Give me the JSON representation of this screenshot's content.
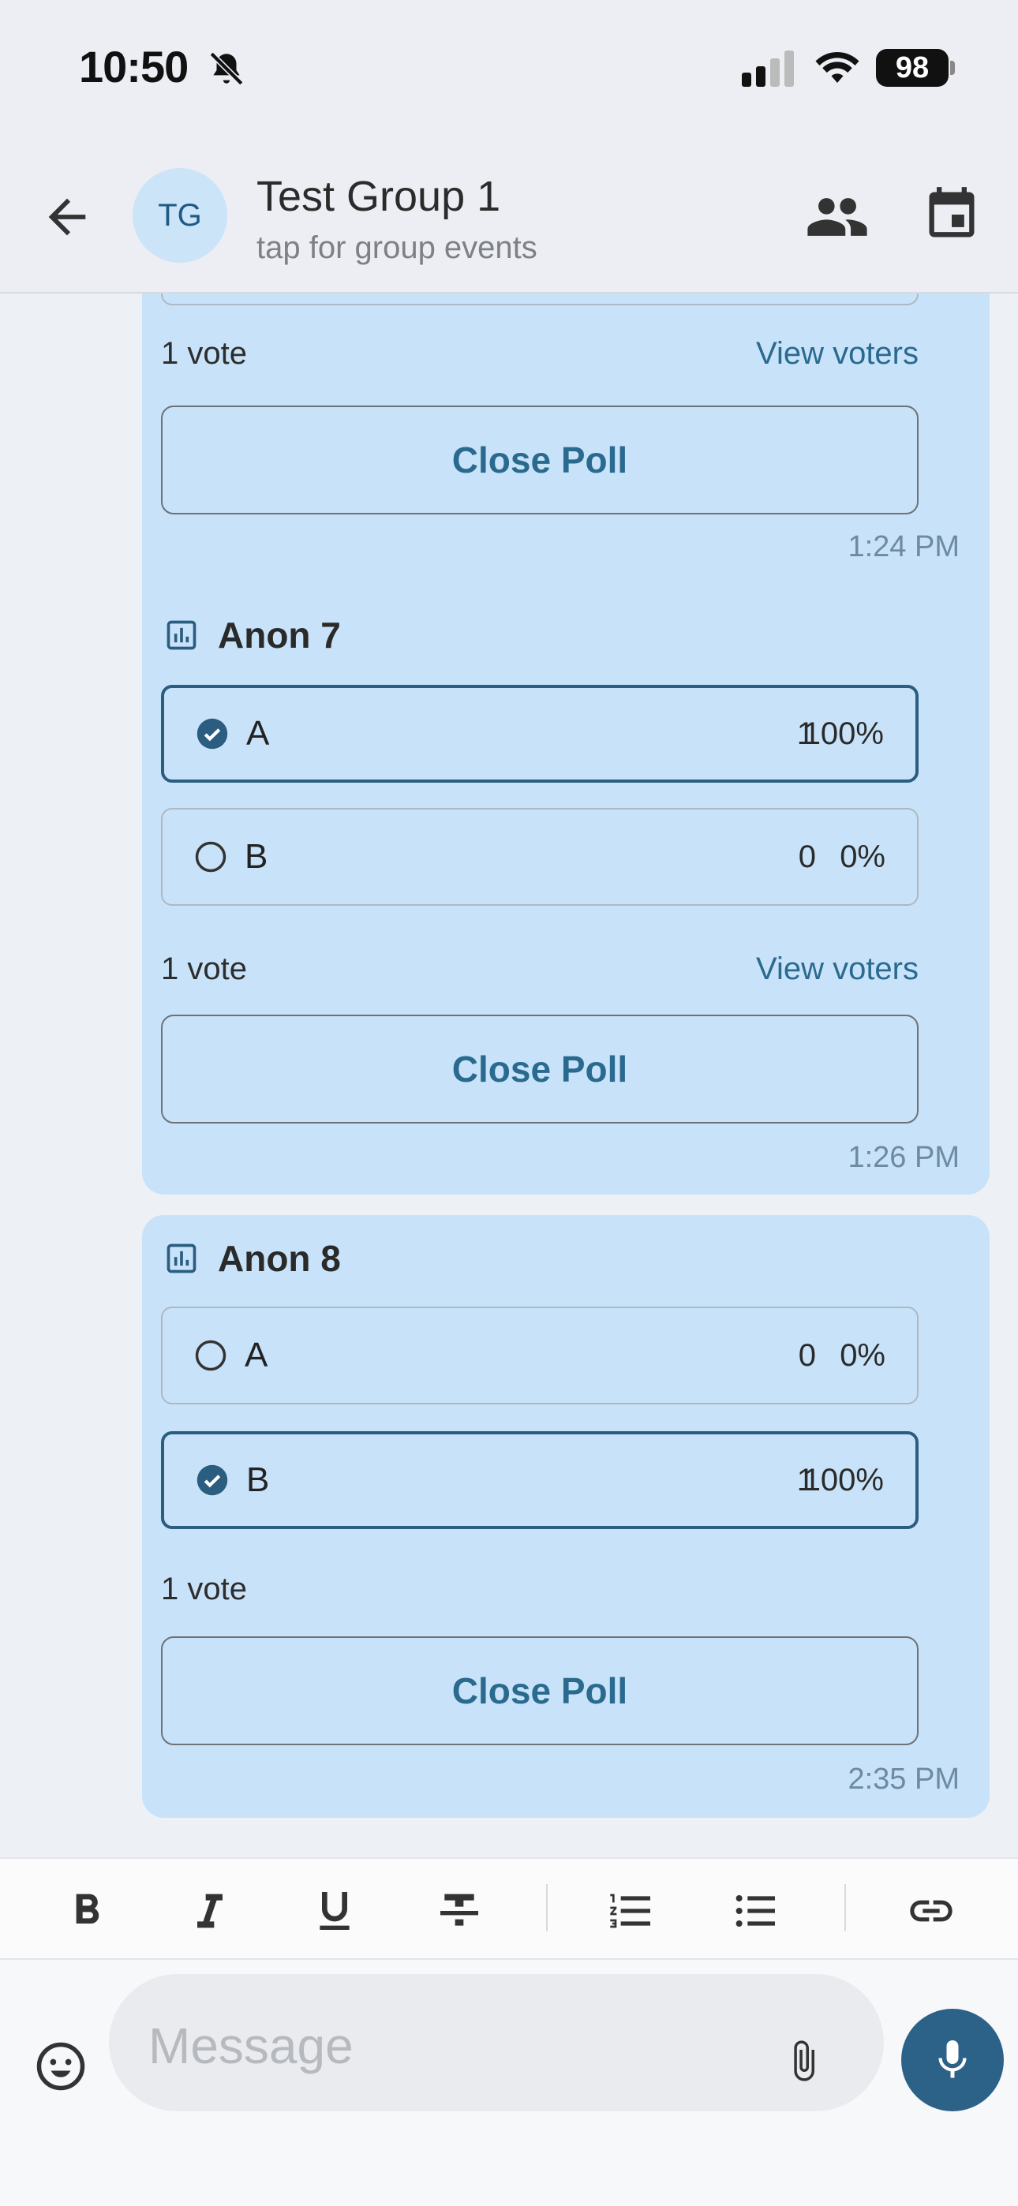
{
  "status_bar": {
    "time": "10:50",
    "battery": "98"
  },
  "header": {
    "avatar_initials": "TG",
    "title": "Test Group 1",
    "subtitle": "tap for group events"
  },
  "messages": [
    {
      "poll_title": "",
      "vote_count": "1 vote",
      "view_voters": "View voters",
      "close_label": "Close Poll",
      "time": "1:24 PM"
    },
    {
      "poll_title": "Anon 7",
      "options": [
        {
          "label": "A",
          "count": "1",
          "percent": "100%",
          "selected": true
        },
        {
          "label": "B",
          "count": "0",
          "percent": "0%",
          "selected": false
        }
      ],
      "vote_count": "1 vote",
      "view_voters": "View voters",
      "close_label": "Close Poll",
      "time": "1:26 PM"
    },
    {
      "poll_title": "Anon 8",
      "options": [
        {
          "label": "A",
          "count": "0",
          "percent": "0%",
          "selected": false
        },
        {
          "label": "B",
          "count": "1",
          "percent": "100%",
          "selected": true
        }
      ],
      "vote_count": "1 vote",
      "close_label": "Close Poll",
      "time": "2:35 PM"
    }
  ],
  "toolbar": {
    "icons": [
      "bold-icon",
      "italic-icon",
      "underline-icon",
      "strikethrough-icon",
      "numbered-list-icon",
      "bulleted-list-icon",
      "link-icon"
    ]
  },
  "composer": {
    "placeholder": "Message"
  },
  "colors": {
    "bubble": "#c8e3f9",
    "accent": "#2c6288",
    "link": "#2b6a8f"
  }
}
